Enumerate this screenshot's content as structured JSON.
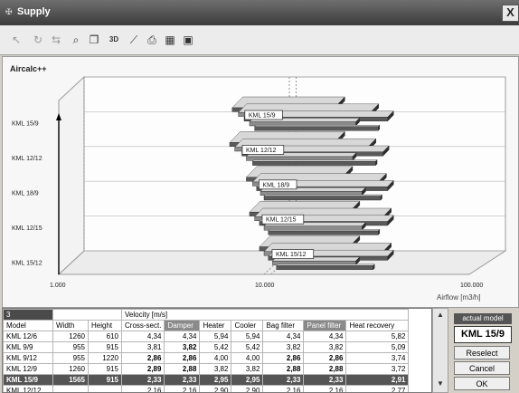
{
  "window": {
    "title": "Supply",
    "close_glyph": "X"
  },
  "toolbar": {
    "view3d_label": "3D"
  },
  "chart_data": {
    "type": "bar",
    "orientation": "horizontal",
    "three_d": true,
    "title": "Aircalc++",
    "xlabel": "Airflow [m3/h]",
    "x_scale": "log",
    "xlim": [
      1000,
      100000
    ],
    "x_ticks": [
      "1.000",
      "10.000",
      "100.000"
    ],
    "categories": [
      "KML 15/9",
      "KML 12/12",
      "KML 18/9",
      "KML 12/15",
      "KML 15/12"
    ],
    "bar_labels": [
      "KML 15/9",
      "KML 12/12",
      "KML 18/9",
      "KML 12/15",
      "KML 15/12"
    ],
    "markers": [
      10000,
      10800
    ],
    "bars": [
      [
        [
          7000,
          22000
        ],
        [
          7500,
          33000
        ],
        [
          8000,
          40000
        ],
        [
          8500,
          28000
        ],
        [
          9000,
          36000
        ]
      ],
      [
        [
          6800,
          22000
        ],
        [
          7200,
          32000
        ],
        [
          7800,
          38000
        ],
        [
          8200,
          27000
        ],
        [
          8800,
          35000
        ]
      ],
      [
        [
          8200,
          24000
        ],
        [
          8800,
          36000
        ],
        [
          9200,
          40000
        ],
        [
          9600,
          30000
        ],
        [
          10000,
          37000
        ]
      ],
      [
        [
          8500,
          26000
        ],
        [
          9000,
          38000
        ],
        [
          9500,
          40000
        ],
        [
          10000,
          30000
        ],
        [
          10500,
          36000
        ]
      ],
      [
        [
          9500,
          26000
        ],
        [
          10000,
          38000
        ],
        [
          10500,
          40000
        ],
        [
          11000,
          28000
        ],
        [
          11500,
          34000
        ]
      ]
    ]
  },
  "grid": {
    "tab_index": "3",
    "group_header": "Velocity [m/s]",
    "columns": [
      "Model",
      "Width",
      "Height",
      "Cross-sect.",
      "Damper",
      "Heater",
      "Cooler",
      "Bag filter",
      "Panel filter",
      "Heat recovery"
    ],
    "rows": [
      [
        "KML 12/6",
        "1260",
        "610",
        "4,34",
        "4,34",
        "5,94",
        "5,94",
        "4,34",
        "4,34",
        "5,82"
      ],
      [
        "KML 9/9",
        "955",
        "915",
        "3,81",
        "3,82",
        "5,42",
        "5,42",
        "3,82",
        "3,82",
        "5,09"
      ],
      [
        "KML 9/12",
        "955",
        "1220",
        "2,86",
        "2,86",
        "4,00",
        "4,00",
        "2,86",
        "2,86",
        "3,74"
      ],
      [
        "KML 12/9",
        "1260",
        "915",
        "2,89",
        "2,88",
        "3,82",
        "3,82",
        "2,88",
        "2,88",
        "3,72"
      ],
      [
        "KML 15/9",
        "1565",
        "915",
        "2,33",
        "2,33",
        "2,95",
        "2,95",
        "2,33",
        "2,33",
        "2,91"
      ],
      [
        "KML 12/12",
        "",
        "",
        "2,16",
        "2,16",
        "2,90",
        "2,90",
        "2,16",
        "2,16",
        "2,77"
      ]
    ],
    "selected_row": 4
  },
  "side": {
    "actual_model_label": "actual model",
    "actual_model_value": "KML 15/9",
    "reselect": "Reselect",
    "cancel": "Cancel",
    "ok": "OK"
  }
}
